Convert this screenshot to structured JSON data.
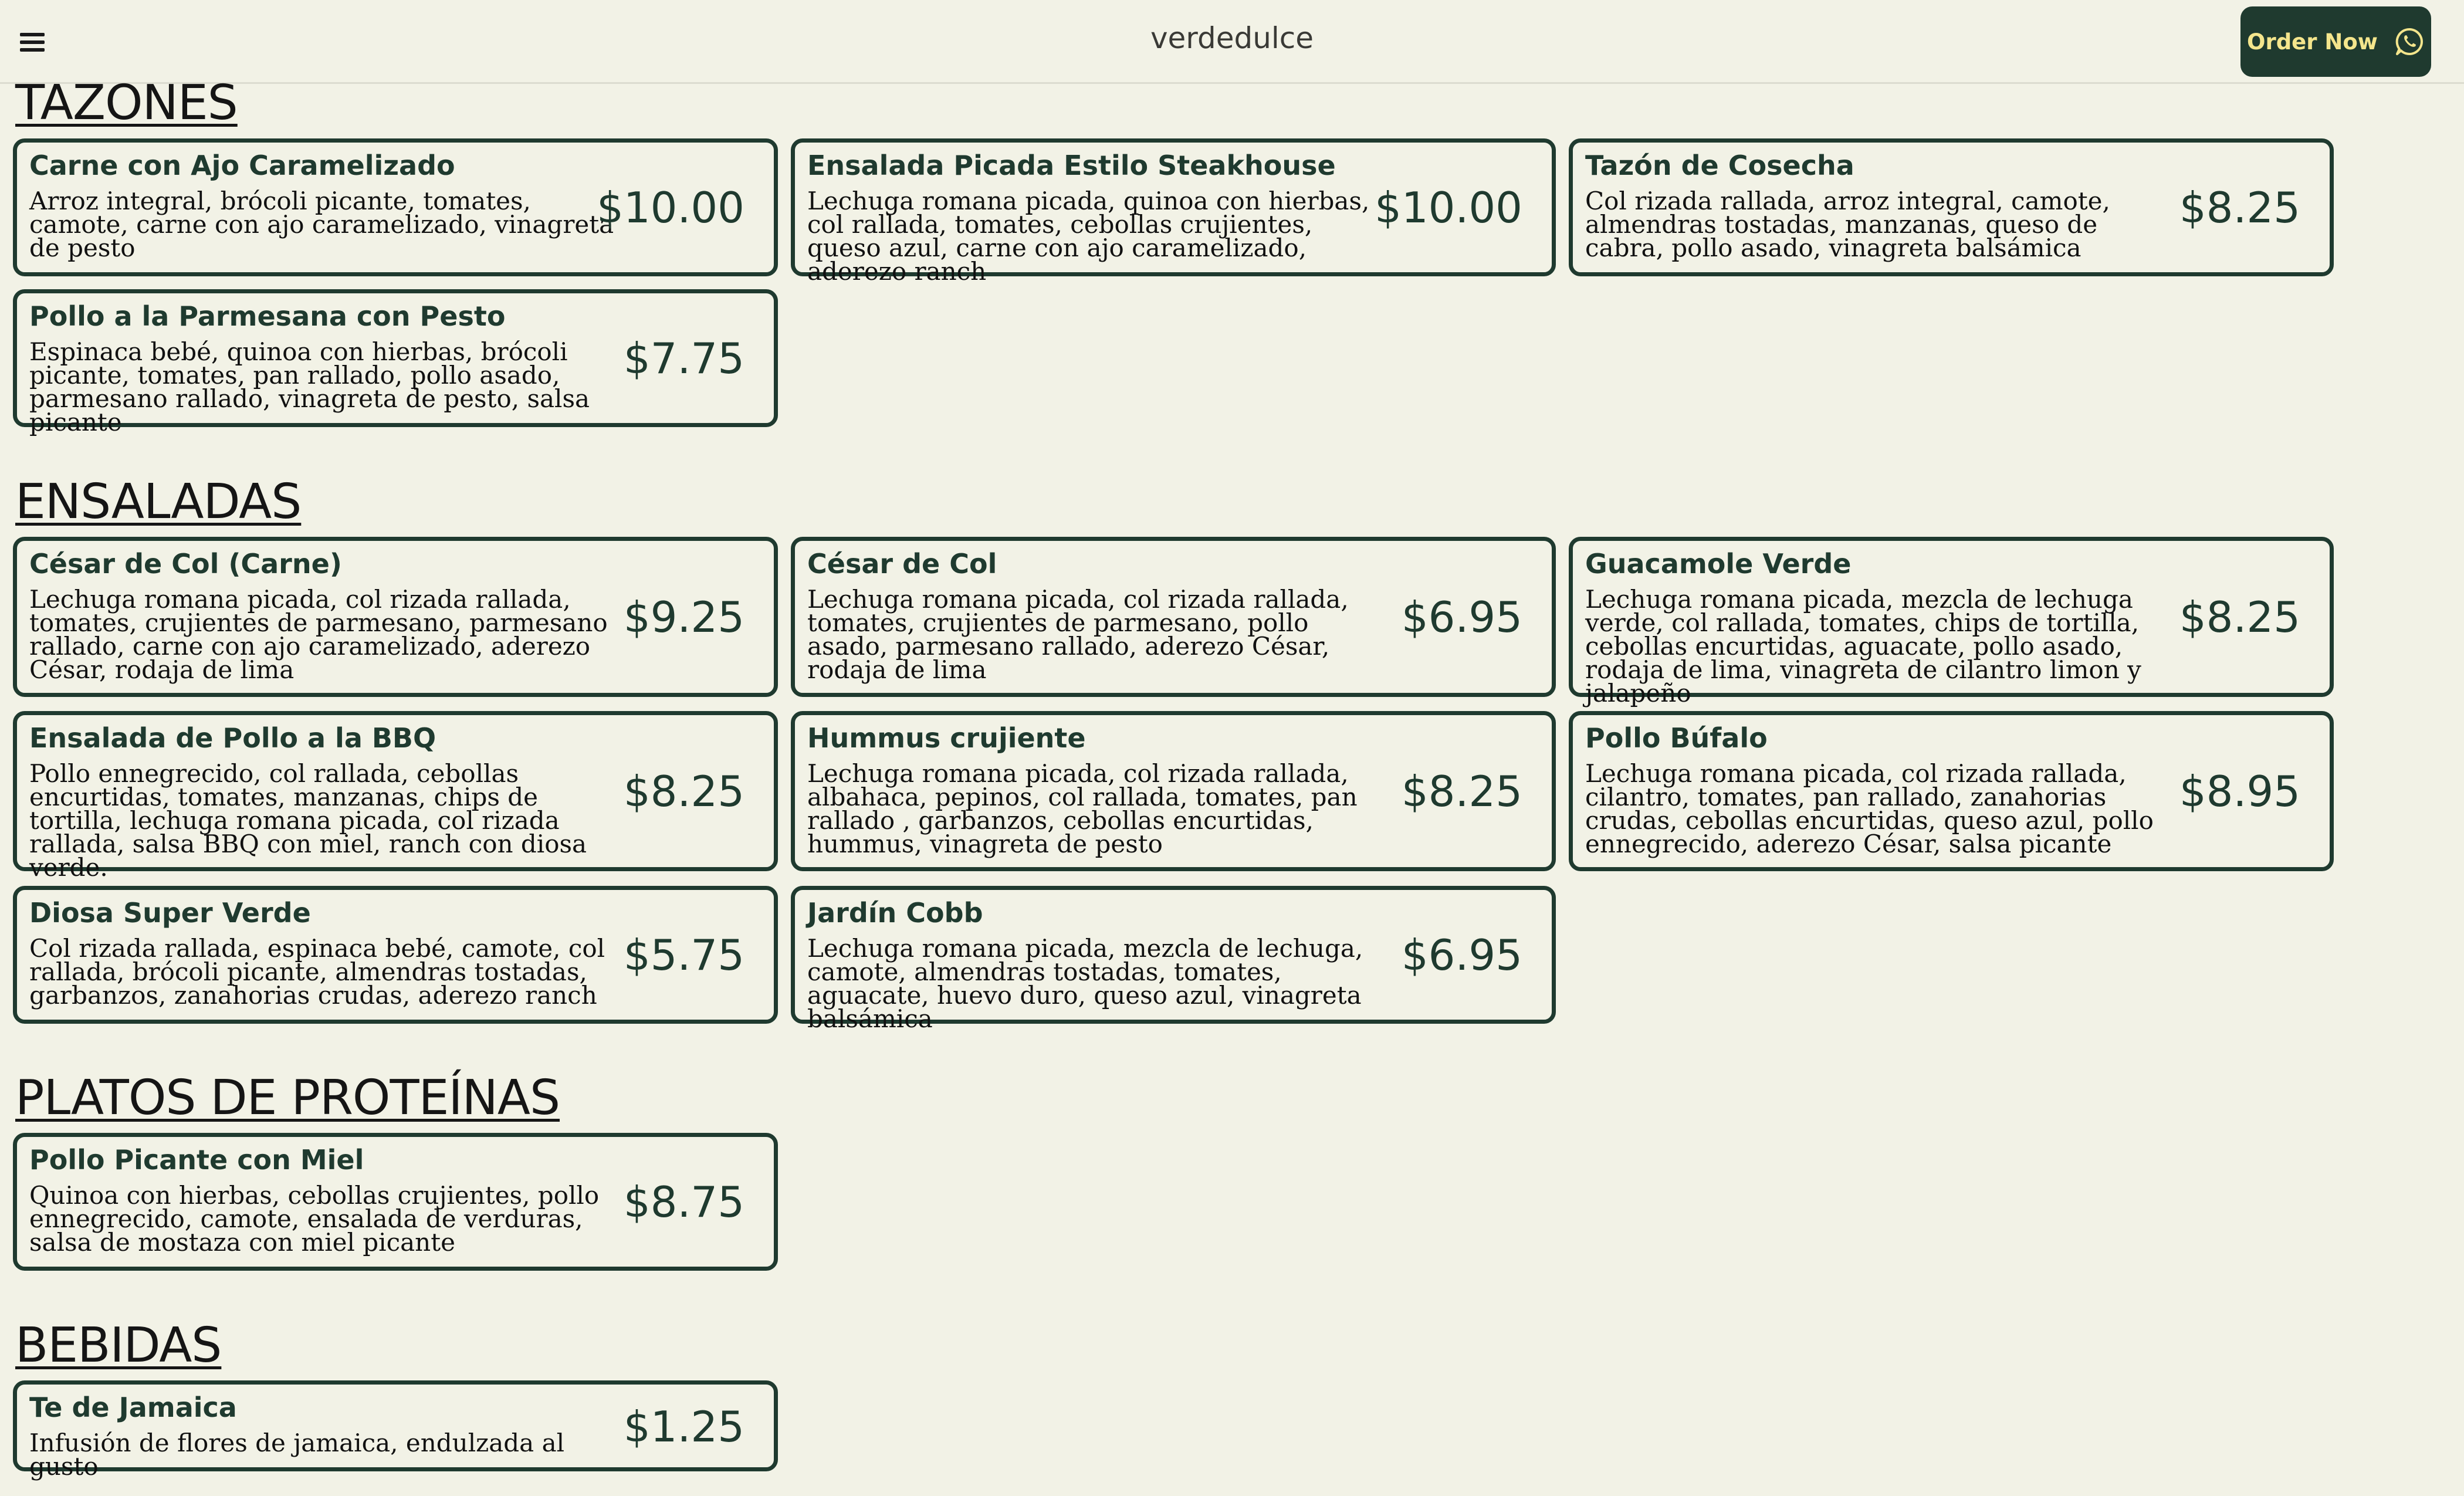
{
  "header": {
    "brand": "verdedulce",
    "order_label": "Order Now",
    "menu_icon": "hamburger-menu-icon",
    "order_icon": "whatsapp-icon"
  },
  "colors": {
    "background": "#f2f2e6",
    "accent": "#1f3a2f",
    "button_text": "#f4e58c"
  },
  "sections": [
    {
      "title": "TAZONES",
      "items": [
        {
          "name": "Carne con Ajo Caramelizado",
          "desc": "Arroz integral, brócoli picante, tomates, camote, carne con ajo caramelizado, vinagreta de pesto",
          "price": "$10.00"
        },
        {
          "name": "Ensalada Picada Estilo Steakhouse",
          "desc": "Lechuga romana picada, quinoa con hierbas, col rallada, tomates, cebollas crujientes, queso azul, carne con ajo caramelizado, aderezo ranch",
          "price": "$10.00"
        },
        {
          "name": "Tazón de Cosecha",
          "desc": "Col rizada rallada, arroz integral, camote, almendras tostadas, manzanas, queso de cabra, pollo asado, vinagreta balsámica",
          "price": "$8.25"
        },
        {
          "name": "Pollo a la Parmesana con Pesto",
          "desc": "Espinaca bebé, quinoa con hierbas, brócoli picante, tomates, pan rallado, pollo asado, parmesano rallado, vinagreta de pesto, salsa picante",
          "price": "$7.75"
        }
      ]
    },
    {
      "title": "ENSALADAS",
      "items": [
        {
          "name": "César de Col (Carne)",
          "desc": "Lechuga romana picada, col rizada rallada, tomates, crujientes de parmesano, parmesano rallado, carne con ajo caramelizado, aderezo César, rodaja de lima",
          "price": "$9.25"
        },
        {
          "name": "César de Col",
          "desc": "Lechuga romana picada, col rizada rallada, tomates, crujientes de parmesano, pollo asado, parmesano rallado, aderezo César, rodaja de lima",
          "price": "$6.95"
        },
        {
          "name": "Guacamole Verde",
          "desc": "Lechuga romana picada, mezcla de lechuga verde, col rallada, tomates, chips de tortilla, cebollas encurtidas, aguacate, pollo asado, rodaja de lima, vinagreta de cilantro limon y jalapeño",
          "price": "$8.25"
        },
        {
          "name": "Ensalada de Pollo a la BBQ",
          "desc": "Pollo ennegrecido, col rallada, cebollas encurtidas, tomates, manzanas, chips de tortilla, lechuga romana picada, col rizada rallada, salsa BBQ con miel, ranch con diosa verde.",
          "price": "$8.25"
        },
        {
          "name": "Hummus crujiente",
          "desc": "Lechuga romana picada, col rizada rallada, albahaca, pepinos, col rallada, tomates, pan rallado , garbanzos, cebollas encurtidas, hummus, vinagreta de pesto",
          "price": "$8.25"
        },
        {
          "name": "Pollo Búfalo",
          "desc": "Lechuga romana picada, col rizada rallada, cilantro, tomates, pan rallado, zanahorias crudas, cebollas encurtidas, queso azul, pollo ennegrecido, aderezo César, salsa picante",
          "price": "$8.95"
        },
        {
          "name": "Diosa Super Verde",
          "desc": "Col rizada rallada, espinaca bebé, camote, col rallada, brócoli picante, almendras tostadas, garbanzos, zanahorias crudas, aderezo ranch",
          "price": "$5.75"
        },
        {
          "name": "Jardín Cobb",
          "desc": "Lechuga romana picada, mezcla de lechuga, camote, almendras tostadas, tomates, aguacate, huevo duro, queso azul, vinagreta balsámica",
          "price": "$6.95"
        }
      ]
    },
    {
      "title": "PLATOS DE PROTEÍNAS",
      "items": [
        {
          "name": "Pollo Picante con Miel",
          "desc": "Quinoa con hierbas, cebollas crujientes, pollo ennegrecido, camote, ensalada de verduras, salsa de mostaza con miel picante",
          "price": "$8.75"
        }
      ]
    },
    {
      "title": "BEBIDAS",
      "items": [
        {
          "name": "Te de Jamaica",
          "desc": "Infusión de flores de jamaica, endulzada al gusto",
          "price": "$1.25"
        }
      ]
    }
  ]
}
